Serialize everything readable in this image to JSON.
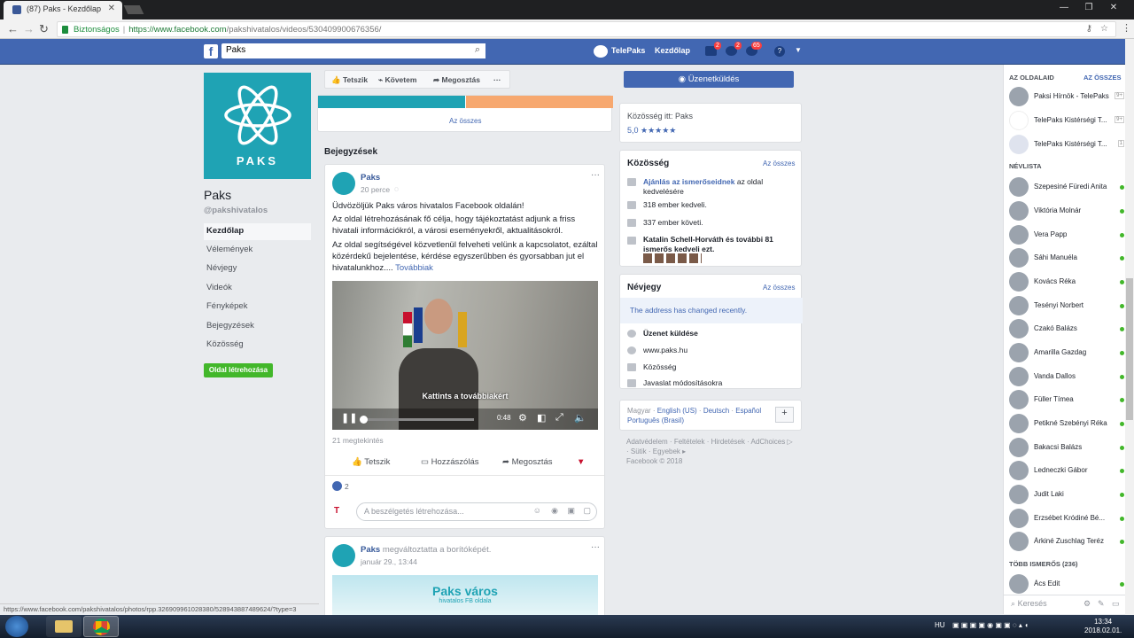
{
  "browser": {
    "tab_title": "(87) Paks - Kezdőlap",
    "secure_label": "Biztonságos",
    "url_host": "https://www.facebook.com",
    "url_path": "/pakshivatalos/videos/530409900676356/"
  },
  "topbar": {
    "search_value": "Paks",
    "page_link": "TelePaks",
    "home_link": "Kezdőlap",
    "friend_badge": "2",
    "msg_badge": "2",
    "notif_badge": "65"
  },
  "page": {
    "cover_label": "PAKS",
    "name": "Paks",
    "handle": "@pakshivatalos",
    "nav": [
      "Kezdőlap",
      "Vélemények",
      "Névjegy",
      "Videók",
      "Fényképek",
      "Bejegyzések",
      "Közösség"
    ],
    "create_button": "Oldal létrehozása"
  },
  "actions": {
    "like": "Tetszik",
    "follow": "Követem",
    "share": "Megosztás",
    "more": "···"
  },
  "middle": {
    "see_all": "Az összes",
    "posts_header": "Bejegyzések"
  },
  "post1": {
    "author": "Paks",
    "time": "20 perce",
    "p1": "Üdvözöljük Paks város hivatalos Facebook oldalán!",
    "p2": "Az oldal létrehozásának fő célja, hogy tájékoztatást adjunk a friss hivatali információkról, a városi eseményekről, aktualitásokról.",
    "p3": "Az oldal segítségével közvetlenül felveheti velünk a kapcsolatot, ezáltal közérdekű bejelentése, kérdése egyszerűbben és gyorsabban jut el hivatalunkhoz....",
    "more_link": "Továbbiak",
    "video_caption": "Kattints a továbbiakért",
    "video_time": "0:48",
    "views": "21 megtekintés",
    "like": "Tetszik",
    "comment": "Hozzászólás",
    "share": "Megosztás",
    "reactions": "2",
    "comment_placeholder": "A beszélgetés létrehozása..."
  },
  "post2": {
    "author": "Paks",
    "action": "megváltoztatta a borítóképét.",
    "time": "január 29., 13:44",
    "image_title": "Paks város",
    "image_subtitle": "hivatalos FB oldala"
  },
  "right": {
    "message_button": "Üzenetküldés",
    "community_here": "Közösség itt: Paks",
    "rating": "5,0 ★★★★★",
    "community": {
      "title": "Közösség",
      "see_all": "Az összes",
      "invite_link": "Ajánlás az ismerőseidnek",
      "invite_rest": "az oldal kedvelésére",
      "likes": "318 ember kedveli.",
      "follows": "337 ember követi.",
      "friends": "Katalin Schell-Horváth és további 81 ismerős kedveli ezt."
    },
    "about": {
      "title": "Névjegy",
      "see_all": "Az összes",
      "notice": "The address has changed recently.",
      "send_message": "Üzenet küldése",
      "website": "www.paks.hu",
      "category": "Közösség",
      "suggest": "Javaslat módosításokra"
    },
    "languages": {
      "current": "Magyar",
      "l1": "English (US)",
      "l2": "Deutsch",
      "l3": "Español",
      "l4": "Português (Brasil)",
      "add": "+"
    },
    "footer": {
      "f1": "Adatvédelem",
      "f2": "Feltételek",
      "f3": "Hirdetések",
      "f4": "AdChoices",
      "f5": "Sütik",
      "f6": "Egyebek",
      "copyright": "Facebook © 2018"
    }
  },
  "chat": {
    "pages_header": "AZ OLDALAID",
    "pages_all": "AZ ÖSSZES",
    "pages": [
      {
        "name": "Paksi Hírnök - TelePaks",
        "count": "9+"
      },
      {
        "name": "TelePaks Kistérségi T...",
        "count": "9+"
      },
      {
        "name": "TelePaks Kistérségi T...",
        "count": "1"
      }
    ],
    "list_header": "NÉVLISTA",
    "contacts": [
      "Szepesiné Füredi Anita",
      "Viktória Molnár",
      "Vera Papp",
      "Sáhi Manuéla",
      "Kovács Réka",
      "Tesényi Norbert",
      "Czakó Balázs",
      "Amarilla Gazdag",
      "Vanda Dallos",
      "Füller Tímea",
      "Petikné Szebényi Réka",
      "Bakacsi Balázs",
      "Ledneczki Gábor",
      "Judit Laki",
      "Erzsébet Kródiné Bé...",
      "Árkiné Zuschlag Teréz"
    ],
    "more_header": "TÖBB ISMERŐS (236)",
    "more_contact": "Ács Edit",
    "search_placeholder": "Keresés"
  },
  "statusbar": "https://www.facebook.com/pakshivatalos/photos/rpp.326909961028380/528943887489624/?type=3",
  "taskbar": {
    "lang": "HU",
    "time": "13:34",
    "date": "2018.02.01."
  }
}
